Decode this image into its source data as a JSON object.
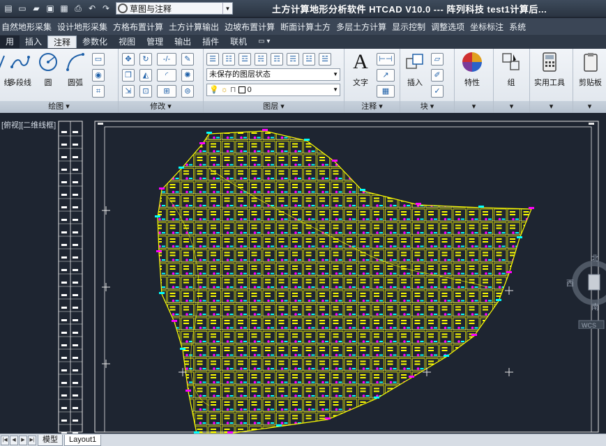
{
  "titlebar": {
    "workspace": "草图与注释",
    "app_title": "土方计算地形分析软件 HTCAD V10.0 --- 阵列科技      test1计算后..."
  },
  "menu": [
    "自然地形采集",
    "设计地形采集",
    "方格布置计算",
    "土方计算输出",
    "边坡布置计算",
    "断面计算土方",
    "多层土方计算",
    "显示控制",
    "调整选项",
    "坐标标注",
    "系统"
  ],
  "tabs": {
    "home": "用",
    "insert": "插入",
    "annotate": "注释",
    "parametric": "参数化",
    "view": "视图",
    "manage": "管理",
    "output": "输出",
    "plugin": "插件",
    "online": "联机"
  },
  "ribbon": {
    "draw": {
      "title": "绘图",
      "polyline_short": "线",
      "polyline": "多段线",
      "circle": "圆",
      "arc": "圆弧"
    },
    "modify": {
      "title": "修改"
    },
    "layers": {
      "title": "图层",
      "state": "未保存的图层状态",
      "current": "0"
    },
    "annotation": {
      "title": "注释",
      "text": "文字"
    },
    "block": {
      "title": "块",
      "insert": "插入"
    },
    "properties": {
      "label": "特性"
    },
    "groups": {
      "label": "组"
    },
    "utilities": {
      "label": "实用工具"
    },
    "clipboard": {
      "label": "剪贴板"
    }
  },
  "viewport": {
    "label": "[俯视][二维线框]"
  },
  "compass": {
    "north": "北",
    "west": "西",
    "south": "南",
    "wcs": "WCS"
  },
  "layout_tabs": {
    "model": "模型",
    "layout1": "Layout1"
  },
  "colors": {
    "grid_yellow": "#ffff00",
    "label_magenta": "#ff00ff",
    "label_cyan": "#00ffff",
    "background": "#1e2531"
  }
}
